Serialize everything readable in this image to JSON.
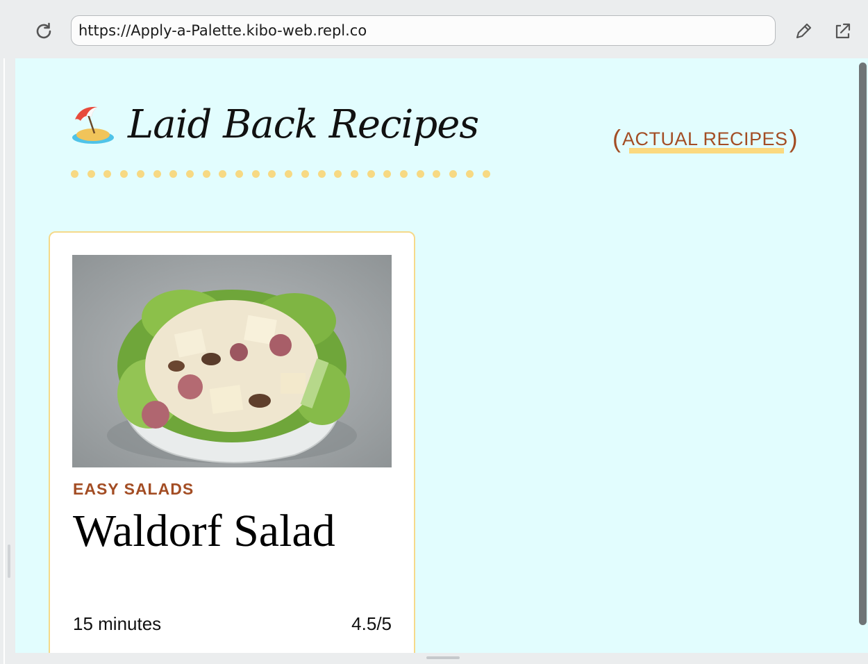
{
  "browser": {
    "url": "https://Apply-a-Palette.kibo-web.repl.co",
    "icons": {
      "reload": "reload-icon",
      "edit": "pencil-icon",
      "open": "external-link-icon"
    }
  },
  "site": {
    "title": "Laid Back Recipes",
    "logo_icon": "beach-umbrella-island-icon",
    "nav": {
      "open_paren": "(",
      "link": "ACTUAL RECIPES",
      "close_paren": ")"
    }
  },
  "recipes": [
    {
      "image": "waldorf-salad-photo",
      "category": "EASY SALADS",
      "title": "Waldorf Salad",
      "time": "15 minutes",
      "rating": "4.5/5"
    }
  ],
  "colors": {
    "page_bg": "#e2fdfe",
    "accent_brown": "#a34d24",
    "accent_yellow": "#fbd97f",
    "card_border": "#f5d98a"
  }
}
